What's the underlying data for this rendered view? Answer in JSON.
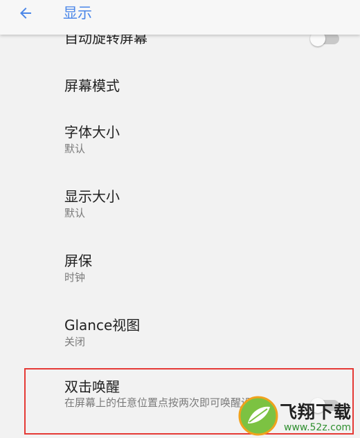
{
  "header": {
    "title": "显示",
    "back_icon": "arrow-left-icon",
    "accent": "#4a86e8"
  },
  "settings": [
    {
      "title": "自动旋转屏幕",
      "toggle": false
    },
    {
      "title": "屏幕模式"
    },
    {
      "title": "字体大小",
      "subtitle": "默认"
    },
    {
      "title": "显示大小",
      "subtitle": "默认"
    },
    {
      "title": "屏保",
      "subtitle": "时钟"
    },
    {
      "title": "Glance视图",
      "subtitle": "关闭"
    },
    {
      "title": "双击唤醒",
      "subtitle": "在屏幕上的任意位置点按两次即可唤醒设备",
      "toggle": false
    }
  ],
  "highlight_color": "#e53935",
  "watermark": {
    "name": "飞翔下载",
    "url": "www.52z.com"
  }
}
